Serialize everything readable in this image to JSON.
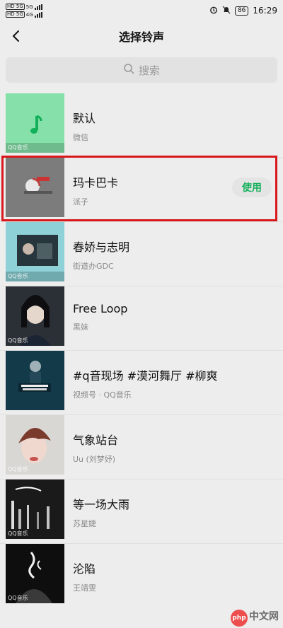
{
  "status_bar": {
    "sim1": "HD 5G",
    "sim2": "HD 5G",
    "signal_label_1": "5G",
    "signal_label_2": "4G",
    "battery": "86",
    "time": "16:29"
  },
  "header": {
    "title": "选择铃声"
  },
  "search": {
    "placeholder": "搜索"
  },
  "items": [
    {
      "name": "默认",
      "sub": "微信",
      "thumb_src": "QQ音乐",
      "thumb_color": "#86e0a9"
    },
    {
      "name": "玛卡巴卡",
      "sub": "派子",
      "thumb_src": "",
      "thumb_color": "#7a7a7a",
      "action": "使用"
    },
    {
      "name": "春娇与志明",
      "sub": "街道办GDC",
      "thumb_src": "QQ音乐",
      "thumb_color": "#8ed1d6"
    },
    {
      "name": "Free Loop",
      "sub": "黑妹",
      "thumb_src": "QQ音乐",
      "thumb_color": "#2b2f36"
    },
    {
      "name": "#q音现场 #漠河舞厅 #柳爽",
      "sub": "视频号 · QQ音乐",
      "thumb_src": "",
      "thumb_color": "#133a49"
    },
    {
      "name": "气象站台",
      "sub": "Uu (刘梦妤)",
      "thumb_src": "QQ音乐",
      "thumb_color": "#d9d7d3"
    },
    {
      "name": "等一场大雨",
      "sub": "苏星婕",
      "thumb_src": "QQ音乐",
      "thumb_color": "#1a1a1a"
    },
    {
      "name": "沦陷",
      "sub": "王靖雯",
      "thumb_src": "QQ音乐",
      "thumb_color": "#0e0e0e"
    }
  ],
  "watermark": {
    "php": "php",
    "text": "中文网"
  },
  "colors": {
    "accent": "#13b05a",
    "highlight": "#d8191c",
    "background": "#ededed"
  }
}
